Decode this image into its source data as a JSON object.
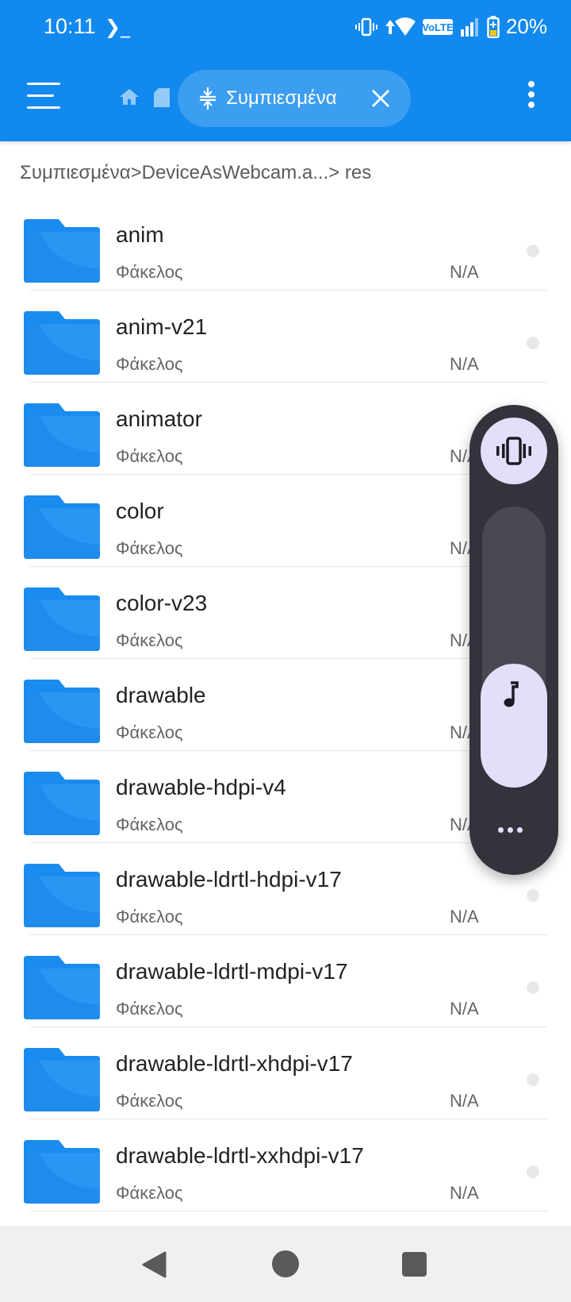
{
  "status_bar": {
    "time": "10:11",
    "battery": "20%",
    "icons": [
      "terminal-icon",
      "vibrate-icon",
      "wifi-icon",
      "volte-icon",
      "signal-icon",
      "battery-icon"
    ],
    "volte_label": "VoLTE"
  },
  "app_bar": {
    "menu_icon": "hamburger-menu-icon",
    "crumb_icons": [
      "home-icon",
      "sd-card-icon"
    ],
    "chip": {
      "icon": "compress-icon",
      "label": "Συμπιεσμένα",
      "close_icon": "close-icon"
    },
    "overflow_icon": "more-vert-icon"
  },
  "path": {
    "text": "Συμπιεσμένα>DeviceAsWebcam.a...> res"
  },
  "files": [
    {
      "name": "anim",
      "type": "Φάκελος",
      "size": "N/A"
    },
    {
      "name": "anim-v21",
      "type": "Φάκελος",
      "size": "N/A"
    },
    {
      "name": "animator",
      "type": "Φάκελος",
      "size": "N/A"
    },
    {
      "name": "color",
      "type": "Φάκελος",
      "size": "N/A"
    },
    {
      "name": "color-v23",
      "type": "Φάκελος",
      "size": "N/A"
    },
    {
      "name": "drawable",
      "type": "Φάκελος",
      "size": "N/A"
    },
    {
      "name": "drawable-hdpi-v4",
      "type": "Φάκελος",
      "size": "N/A"
    },
    {
      "name": "drawable-ldrtl-hdpi-v17",
      "type": "Φάκελος",
      "size": "N/A"
    },
    {
      "name": "drawable-ldrtl-mdpi-v17",
      "type": "Φάκελος",
      "size": "N/A"
    },
    {
      "name": "drawable-ldrtl-xhdpi-v17",
      "type": "Φάκελος",
      "size": "N/A"
    },
    {
      "name": "drawable-ldrtl-xxhdpi-v17",
      "type": "Φάκελος",
      "size": "N/A"
    }
  ],
  "volume_panel": {
    "mode_icon": "vibrate-icon",
    "stream_icon": "music-note-icon",
    "more_icon": "more-horiz-icon",
    "level": 0.44
  },
  "nav_bar": {
    "icons": [
      "back-icon",
      "home-icon",
      "recents-icon"
    ]
  },
  "colors": {
    "primary": "#1289ee",
    "folder": "#1a8cf0",
    "volume_panel": "#34323a",
    "volume_accent": "#e2dffa"
  }
}
